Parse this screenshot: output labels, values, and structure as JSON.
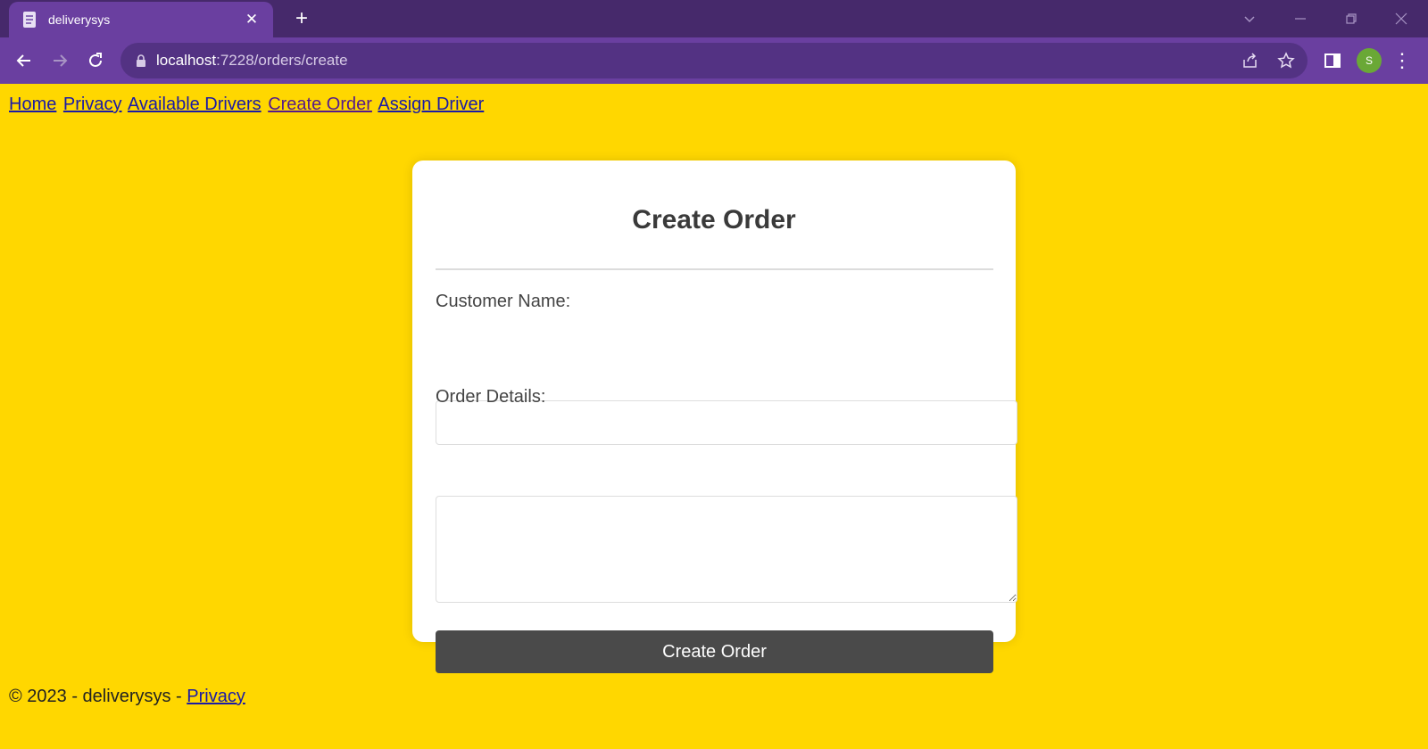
{
  "browser": {
    "tab_title": "deliverysys",
    "url_host": "localhost",
    "url_path": ":7228/orders/create",
    "profile_initial": "S",
    "accent": "#6a3fa0",
    "tabstrip_color": "#46296b"
  },
  "nav": {
    "links": [
      "Home",
      "Privacy",
      "Available Drivers",
      "Create Order",
      "Assign Driver"
    ]
  },
  "form": {
    "title": "Create Order",
    "customer_label": "Customer Name:",
    "customer_value": "",
    "details_label": "Order Details:",
    "details_value": "",
    "submit_label": "Create Order"
  },
  "footer": {
    "text": "© 2023 - deliverysys - ",
    "link": "Privacy"
  },
  "colors": {
    "page_bg": "#ffd700",
    "button_bg": "#4a4a4a"
  }
}
